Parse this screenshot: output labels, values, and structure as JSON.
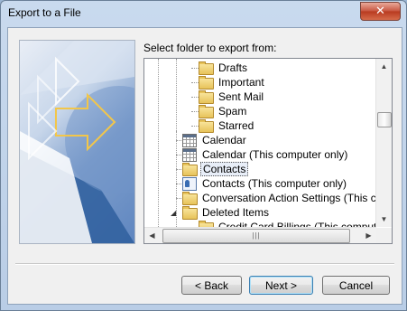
{
  "window": {
    "title": "Export to a File",
    "close_glyph": "✕"
  },
  "prompt": "Select folder to export from:",
  "tree": {
    "items": [
      {
        "label": "Drafts",
        "icon": "folder-icon"
      },
      {
        "label": "Important",
        "icon": "folder-icon"
      },
      {
        "label": "Sent Mail",
        "icon": "folder-icon"
      },
      {
        "label": "Spam",
        "icon": "folder-icon"
      },
      {
        "label": "Starred",
        "icon": "folder-icon"
      },
      {
        "label": "Calendar",
        "icon": "calendar-icon"
      },
      {
        "label": "Calendar (This computer only)",
        "icon": "calendar-icon"
      },
      {
        "label": "Contacts",
        "icon": "folder-icon",
        "selected": true
      },
      {
        "label": "Contacts (This computer only)",
        "icon": "contact-icon"
      },
      {
        "label": "Conversation Action Settings (This c",
        "icon": "folder-icon"
      },
      {
        "label": "Deleted Items",
        "icon": "folder-icon",
        "expanded": true
      },
      {
        "label": "Credit Card Billings (This comput",
        "icon": "folder-icon"
      }
    ],
    "expander_glyph": "◢"
  },
  "scroll": {
    "up": "▲",
    "down": "▼",
    "left": "◀",
    "right": "▶",
    "grip": "|||"
  },
  "buttons": {
    "back": "< Back",
    "next": "Next >",
    "cancel": "Cancel"
  }
}
